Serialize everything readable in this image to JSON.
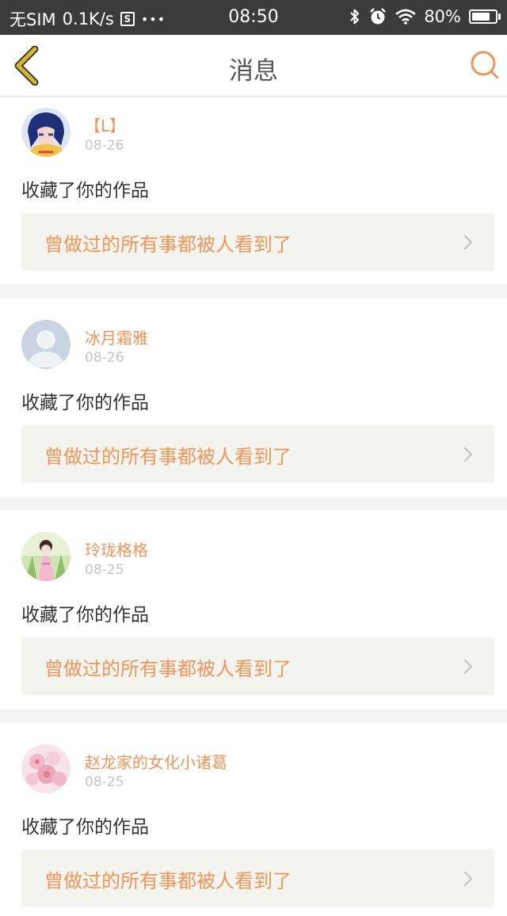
{
  "status_bar": {
    "carrier": "无SIM",
    "speed": "0.1K/s",
    "s_badge": "S",
    "dots": "•••",
    "time": "08:50",
    "battery_percent": "80%",
    "battery_level": 0.8
  },
  "nav": {
    "title": "消息"
  },
  "colors": {
    "accent": "#f0945a",
    "back_icon": "#c9a61f"
  },
  "messages": [
    {
      "user": "【L】",
      "date": "08-26",
      "action": "收藏了你的作品",
      "work_title": "曾做过的所有事都被人看到了",
      "avatar": "anime-blue-hair-avatar"
    },
    {
      "user": "冰月霜雅",
      "date": "08-26",
      "action": "收藏了你的作品",
      "work_title": "曾做过的所有事都被人看到了",
      "avatar": "default-person-avatar"
    },
    {
      "user": "玲珑格格",
      "date": "08-25",
      "action": "收藏了你的作品",
      "work_title": "曾做过的所有事都被人看到了",
      "avatar": "costume-girl-avatar"
    },
    {
      "user": "赵龙家的女化小诸葛",
      "date": "08-25",
      "action": "收藏了你的作品",
      "work_title": "曾做过的所有事都被人看到了",
      "avatar": "pink-flower-avatar"
    }
  ]
}
